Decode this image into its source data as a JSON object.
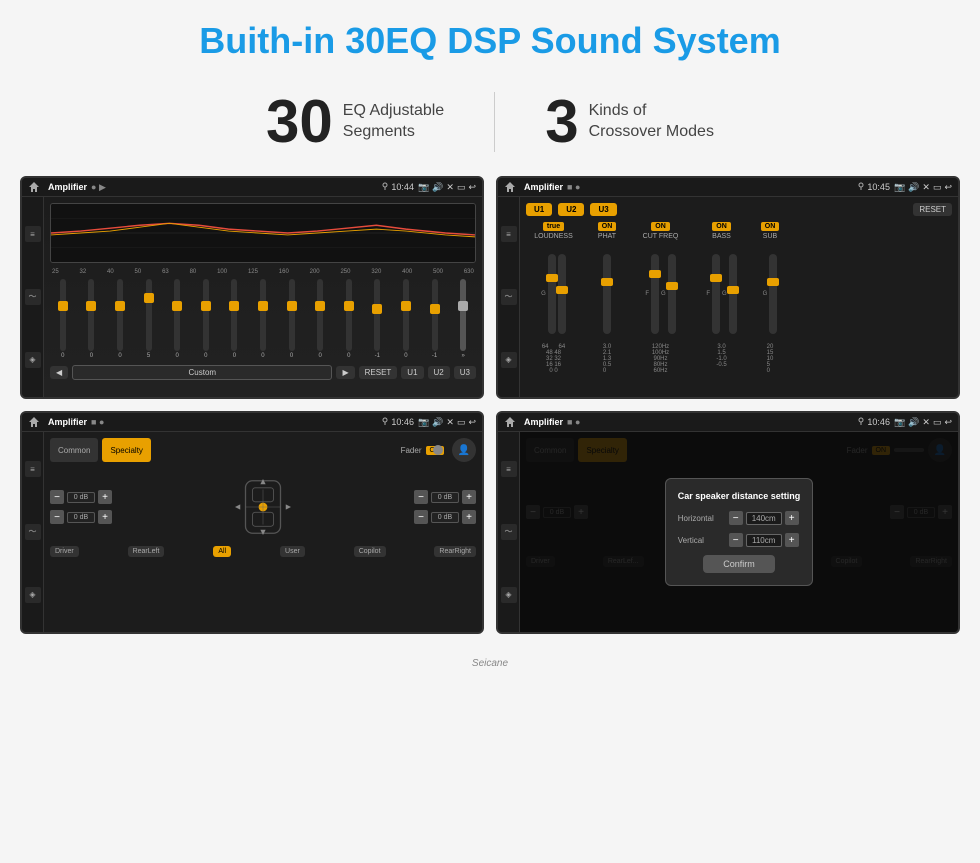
{
  "page": {
    "title": "Buith-in 30EQ DSP Sound System"
  },
  "stats": [
    {
      "number": "30",
      "label": "EQ Adjustable\nSegments"
    },
    {
      "number": "3",
      "label": "Kinds of\nCrossover Modes"
    }
  ],
  "screen1": {
    "status_bar": {
      "app": "Amplifier",
      "time": "10:44"
    },
    "freq_labels": [
      "25",
      "32",
      "40",
      "50",
      "63",
      "80",
      "100",
      "125",
      "160",
      "200",
      "250",
      "320",
      "400",
      "500",
      "630"
    ],
    "slider_values": [
      "0",
      "0",
      "0",
      "5",
      "0",
      "0",
      "0",
      "0",
      "0",
      "0",
      "0",
      "-1",
      "0",
      "-1"
    ],
    "buttons": {
      "play": "▶",
      "back": "◀",
      "preset": "Custom",
      "reset": "RESET",
      "u1": "U1",
      "u2": "U2",
      "u3": "U3"
    }
  },
  "screen2": {
    "status_bar": {
      "app": "Amplifier",
      "time": "10:45"
    },
    "u_buttons": [
      "U1",
      "U2",
      "U3",
      "RESET"
    ],
    "columns": [
      {
        "label": "LOUDNESS",
        "on": true
      },
      {
        "label": "PHAT",
        "on": true
      },
      {
        "label": "CUT FREQ",
        "on": true
      },
      {
        "label": "BASS",
        "on": true
      },
      {
        "label": "SUB",
        "on": true
      }
    ]
  },
  "screen3": {
    "status_bar": {
      "app": "Amplifier",
      "time": "10:46"
    },
    "tabs": [
      "Common",
      "Specialty"
    ],
    "fader_label": "Fader",
    "fader_on": "ON",
    "volumes": [
      {
        "label": "0 dB",
        "side": "left-top"
      },
      {
        "label": "0 dB",
        "side": "right-top"
      },
      {
        "label": "0 dB",
        "side": "left-bottom"
      },
      {
        "label": "0 dB",
        "side": "right-bottom"
      }
    ],
    "bottom_btns": [
      "Driver",
      "RearLeft",
      "All",
      "User",
      "Copilot",
      "RearRight"
    ]
  },
  "screen4": {
    "status_bar": {
      "app": "Amplifier",
      "time": "10:46"
    },
    "tabs": [
      "Common",
      "Specialty"
    ],
    "dialog": {
      "title": "Car speaker distance setting",
      "horizontal_label": "Horizontal",
      "horizontal_val": "140cm",
      "vertical_label": "Vertical",
      "vertical_val": "110cm",
      "confirm_btn": "Confirm"
    },
    "speaker_btns": {
      "driver": "Driver",
      "rear_left": "RearLef...",
      "user": "User",
      "copilot": "Copilot",
      "rear_right": "RearRight"
    },
    "volumes": [
      {
        "label": "0 dB"
      },
      {
        "label": "0 dB"
      }
    ]
  },
  "watermark": "Seicane"
}
